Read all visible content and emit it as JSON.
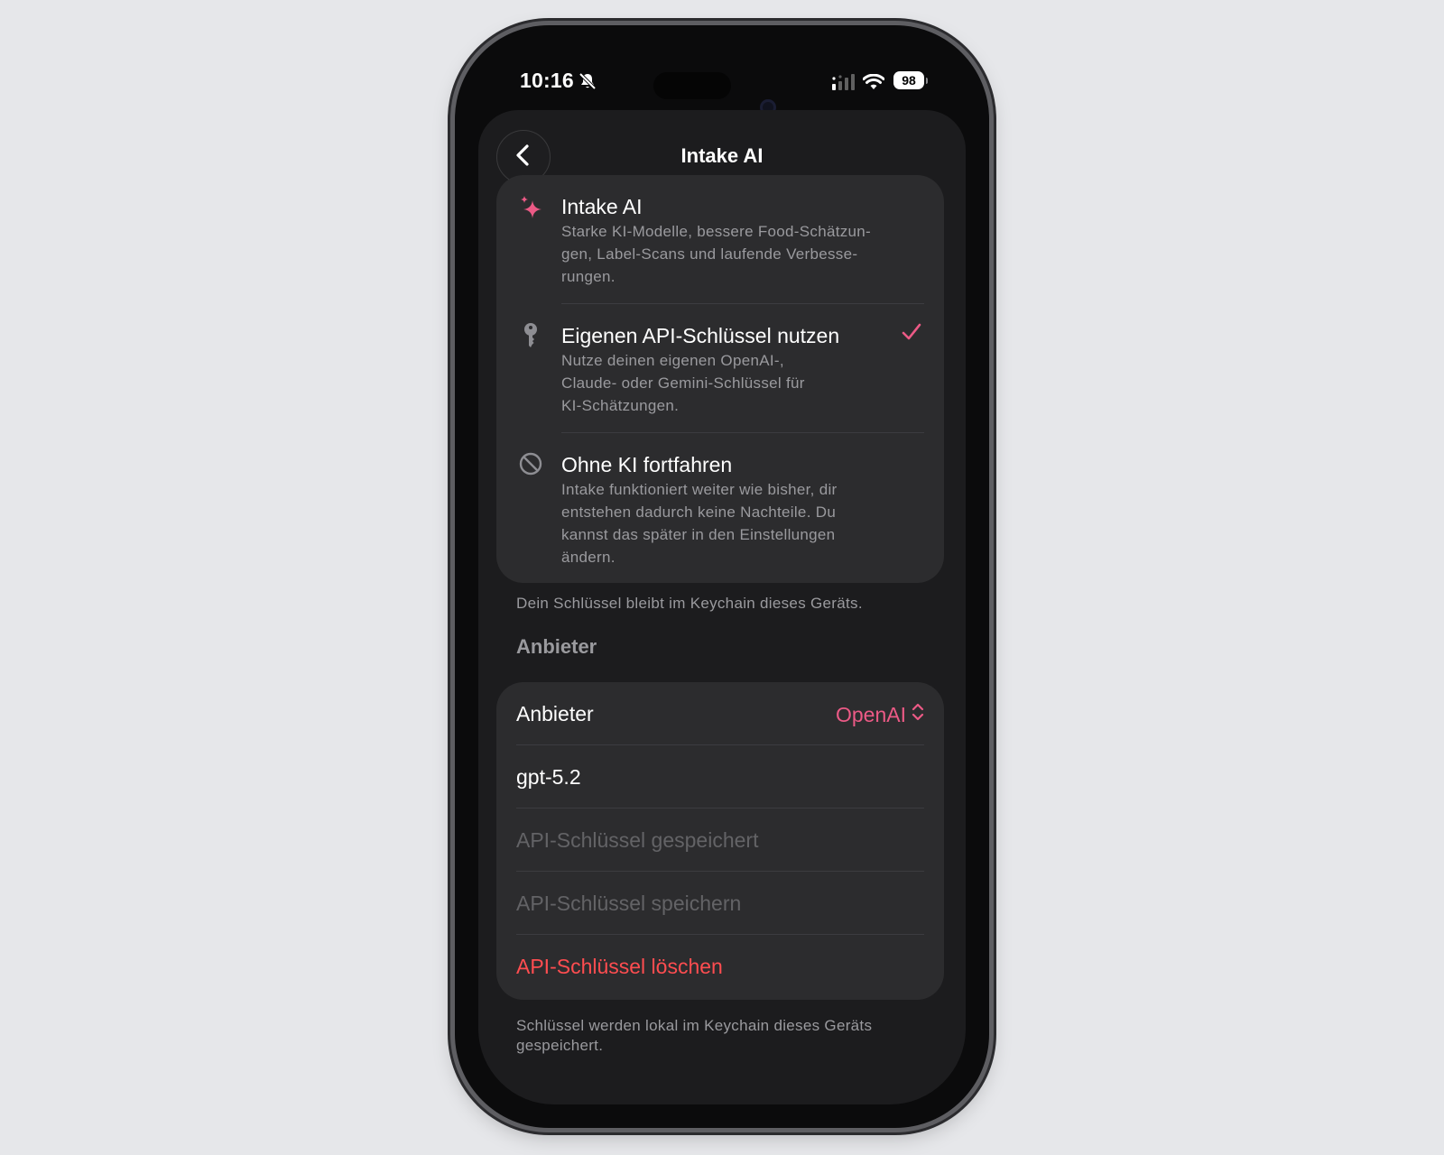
{
  "status_bar": {
    "time": "10:16",
    "battery": "98",
    "icons": [
      "bell-slash-icon",
      "signal-icon",
      "wifi-icon",
      "battery-icon"
    ]
  },
  "nav": {
    "title": "Intake AI",
    "back_icon": "chevron-left-icon"
  },
  "options": [
    {
      "title": "Intake AI",
      "description": "Starke KI-Modelle, bessere Food-Schätzun-gen, Label-Scans und laufende Verbesse-rungen.",
      "description_lines": [
        "Starke KI-Modelle, bessere Food-Schätzun-",
        "gen, Label-Scans und laufende Verbesse-",
        "rungen."
      ],
      "icon": "sparkle-icon",
      "selected": false
    },
    {
      "title": "Eigenen API-Schlüssel nutzen",
      "description_lines": [
        "Nutze deinen eigenen OpenAI-,",
        "Claude- oder Gemini-Schlüssel für",
        "KI-Schätzungen."
      ],
      "icon": "key-icon",
      "selected": true
    },
    {
      "title": "Ohne KI fortfahren",
      "description_lines": [
        "Intake funktioniert weiter wie bisher, dir",
        "entstehen dadurch keine Nachteile. Du",
        "kannst das später in den Einstellungen",
        "ändern."
      ],
      "icon": "prohibited-icon",
      "selected": false
    }
  ],
  "options_footnote": "Dein Schlüssel bleibt im Keychain dieses Geräts.",
  "provider_section": {
    "header": "Anbieter",
    "provider_label": "Anbieter",
    "provider_value": "OpenAI",
    "model_value": "gpt-5.2",
    "key_saved_placeholder": "API-Schlüssel gespeichert",
    "save_key_label": "API-Schlüssel speichern",
    "delete_key_label": "API-Schlüssel löschen",
    "footnote_lines": [
      "Schlüssel werden lokal im Keychain dieses Geräts",
      "gespeichert."
    ]
  },
  "colors": {
    "accent": "#ec5a86",
    "danger": "#ff4d50",
    "background": "#1c1c1e",
    "card": "#2c2c2e"
  }
}
